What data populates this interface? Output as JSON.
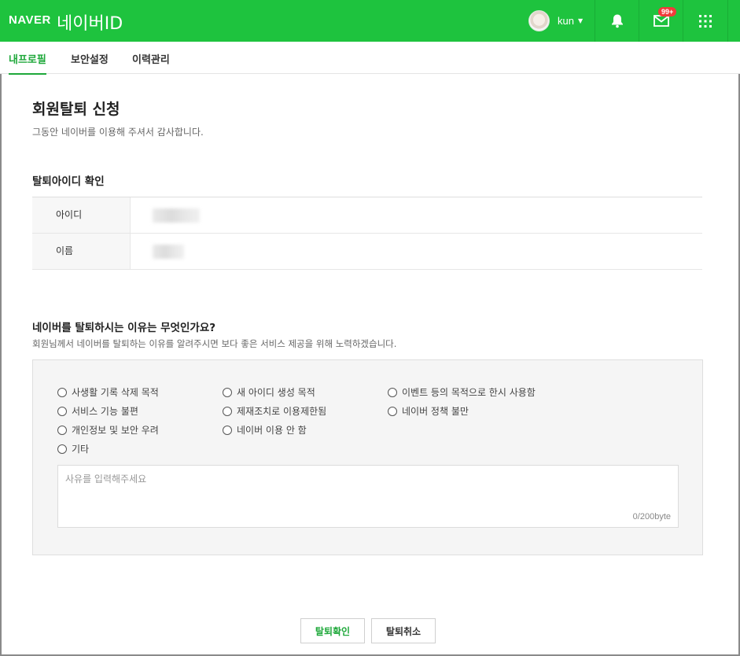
{
  "header": {
    "logo": "NAVER",
    "service_title": "네이버ID",
    "username": "kun",
    "mail_badge": "99+",
    "brand_color": "#1ec33e"
  },
  "tabs": [
    {
      "label": "내프로필",
      "active": true
    },
    {
      "label": "보안설정",
      "active": false
    },
    {
      "label": "이력관리",
      "active": false
    }
  ],
  "page": {
    "title": "회원탈퇴 신청",
    "subtitle": "그동안 네이버를 이용해 주셔서 감사합니다."
  },
  "id_section": {
    "title": "탈퇴아이디 확인",
    "rows": [
      {
        "label": "아이디"
      },
      {
        "label": "이름"
      }
    ]
  },
  "reason_section": {
    "title": "네이버를 탈퇴하시는 이유는 무엇인가요?",
    "subtitle": "회원님께서 네이버를 탈퇴하는 이유를 알려주시면 보다 좋은 서비스 제공을 위해 노력하겠습니다.",
    "options": [
      "사생활 기록 삭제 목적",
      "새 아이디 생성 목적",
      "이벤트 등의 목적으로 한시 사용함",
      "서비스 기능 불편",
      "제재조치로 이용제한됨",
      "네이버 정책 불만",
      "개인정보 및 보안 우려",
      "네이버 이용 안 함",
      "기타"
    ],
    "textarea_placeholder": "사유를 입력해주세요",
    "byte_counter": "0/200byte"
  },
  "buttons": {
    "confirm": "탈퇴확인",
    "cancel": "탈퇴취소"
  },
  "icons": {
    "notifications": "bell-icon",
    "mail": "envelope-icon",
    "apps": "grid-icon"
  }
}
